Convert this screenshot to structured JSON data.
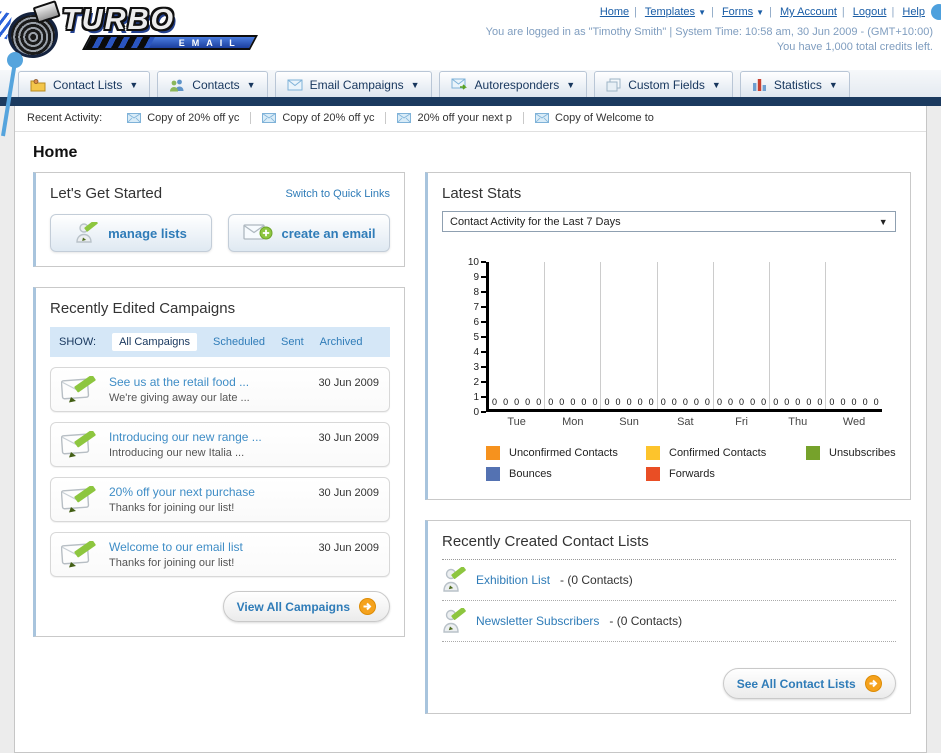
{
  "colors": {
    "navy_bar": "#1b3a5f",
    "link_blue": "#2f7cb8",
    "header_link_blue": "#1a5da6",
    "accent_orange": "#f5a21d",
    "filter_bar_bg": "#d5e7f7"
  },
  "logo": {
    "title": "TURBO",
    "subtitle": "EMAIL"
  },
  "header": {
    "links": [
      {
        "label": "Home",
        "caret": false
      },
      {
        "label": "Templates",
        "caret": true
      },
      {
        "label": "Forms",
        "caret": true
      },
      {
        "label": "My Account",
        "caret": false
      },
      {
        "label": "Logout",
        "caret": false
      },
      {
        "label": "Help",
        "caret": false
      }
    ],
    "login_info": "You are logged in as \"Timothy Smith\" | System Time: 10:58 am, 30 Jun 2009 - (GMT+10:00)",
    "credits_info": "You have 1,000 total credits left."
  },
  "nav": {
    "tabs": [
      {
        "label": "Contact Lists"
      },
      {
        "label": "Contacts"
      },
      {
        "label": "Email Campaigns"
      },
      {
        "label": "Autoresponders"
      },
      {
        "label": "Custom Fields"
      },
      {
        "label": "Statistics"
      }
    ]
  },
  "recent_activity": {
    "label": "Recent Activity:",
    "items": [
      "Copy of 20% off yc",
      "Copy of 20% off yc",
      "20% off your next p",
      "Copy of Welcome to"
    ]
  },
  "page": {
    "title": "Home"
  },
  "get_started": {
    "title": "Let's Get Started",
    "switch_link": "Switch to Quick Links",
    "manage_lists_label": "manage lists",
    "create_email_label": "create an email"
  },
  "campaigns": {
    "title": "Recently Edited Campaigns",
    "show_label": "SHOW:",
    "filters": [
      "All Campaigns",
      "Scheduled",
      "Sent",
      "Archived"
    ],
    "active_filter": "All Campaigns",
    "items": [
      {
        "title": "See us at the retail food ...",
        "subtitle": "We're giving away our late ...",
        "date": "30 Jun 2009"
      },
      {
        "title": "Introducing our new range ...",
        "subtitle": "Introducing our new Italia ...",
        "date": "30 Jun 2009"
      },
      {
        "title": "20% off your next purchase",
        "subtitle": "Thanks for joining our list!",
        "date": "30 Jun 2009"
      },
      {
        "title": "Welcome to our email list",
        "subtitle": "Thanks for joining our list!",
        "date": "30 Jun 2009"
      }
    ],
    "view_all_label": "View All Campaigns"
  },
  "stats": {
    "title": "Latest Stats",
    "dropdown_value": "Contact Activity for the Last 7 Days"
  },
  "chart_data": {
    "type": "bar",
    "title": "Contact Activity for the Last 7 Days",
    "categories": [
      "Tue",
      "Mon",
      "Sun",
      "Sat",
      "Fri",
      "Thu",
      "Wed"
    ],
    "series": [
      {
        "name": "Unconfirmed Contacts",
        "color": "#f6921e",
        "values": [
          0,
          0,
          0,
          0,
          0,
          0,
          0
        ]
      },
      {
        "name": "Confirmed Contacts",
        "color": "#fdc42c",
        "values": [
          0,
          0,
          0,
          0,
          0,
          0,
          0
        ]
      },
      {
        "name": "Unsubscribes",
        "color": "#76a22b",
        "values": [
          0,
          0,
          0,
          0,
          0,
          0,
          0
        ]
      },
      {
        "name": "Bounces",
        "color": "#5472b2",
        "values": [
          0,
          0,
          0,
          0,
          0,
          0,
          0
        ]
      },
      {
        "name": "Forwards",
        "color": "#e94e25",
        "values": [
          0,
          0,
          0,
          0,
          0,
          0,
          0
        ]
      }
    ],
    "ylim": [
      0,
      10
    ],
    "grid": "vertical-between-groups",
    "legend_position": "bottom",
    "value_labels_shown": true
  },
  "contact_lists": {
    "title": "Recently Created Contact Lists",
    "items": [
      {
        "name": "Exhibition List",
        "suffix": " - (0 Contacts)"
      },
      {
        "name": "Newsletter Subscribers",
        "suffix": " - (0 Contacts)"
      }
    ],
    "see_all_label": "See All Contact Lists"
  }
}
